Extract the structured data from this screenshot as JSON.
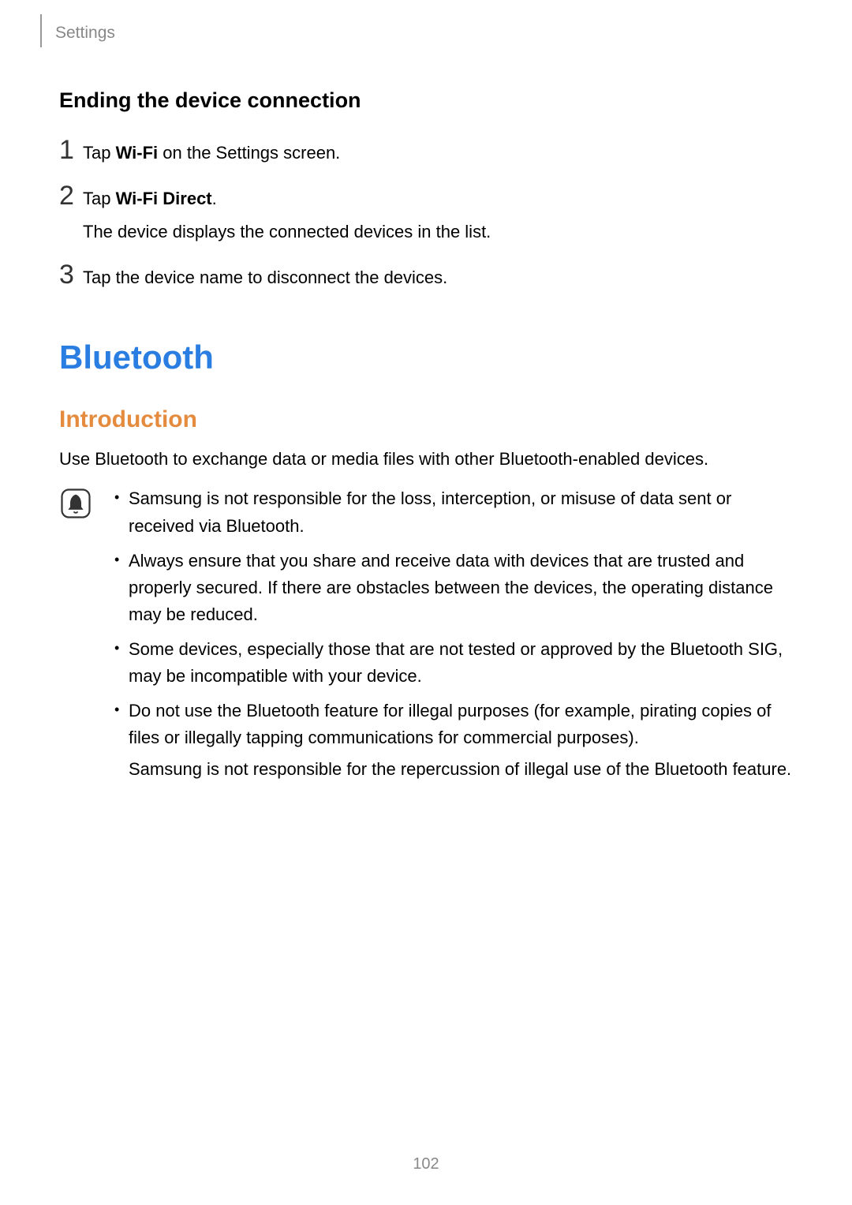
{
  "breadcrumb": "Settings",
  "subsection_heading": "Ending the device connection",
  "steps": [
    {
      "number": "1",
      "prefix": "Tap ",
      "bold": "Wi-Fi",
      "suffix": " on the Settings screen.",
      "desc": ""
    },
    {
      "number": "2",
      "prefix": "Tap ",
      "bold": "Wi-Fi Direct",
      "suffix": ".",
      "desc": "The device displays the connected devices in the list."
    },
    {
      "number": "3",
      "prefix": "Tap the device name to disconnect the devices.",
      "bold": "",
      "suffix": "",
      "desc": ""
    }
  ],
  "h1": "Bluetooth",
  "h2": "Introduction",
  "intro_text": "Use Bluetooth to exchange data or media files with other Bluetooth-enabled devices.",
  "notes": [
    {
      "text": "Samsung is not responsible for the loss, interception, or misuse of data sent or received via Bluetooth.",
      "sub": ""
    },
    {
      "text": "Always ensure that you share and receive data with devices that are trusted and properly secured. If there are obstacles between the devices, the operating distance may be reduced.",
      "sub": ""
    },
    {
      "text": "Some devices, especially those that are not tested or approved by the Bluetooth SIG, may be incompatible with your device.",
      "sub": ""
    },
    {
      "text": "Do not use the Bluetooth feature for illegal purposes (for example, pirating copies of files or illegally tapping communications for commercial purposes).",
      "sub": "Samsung is not responsible for the repercussion of illegal use of the Bluetooth feature."
    }
  ],
  "page_number": "102",
  "bullet_glyph": "•"
}
